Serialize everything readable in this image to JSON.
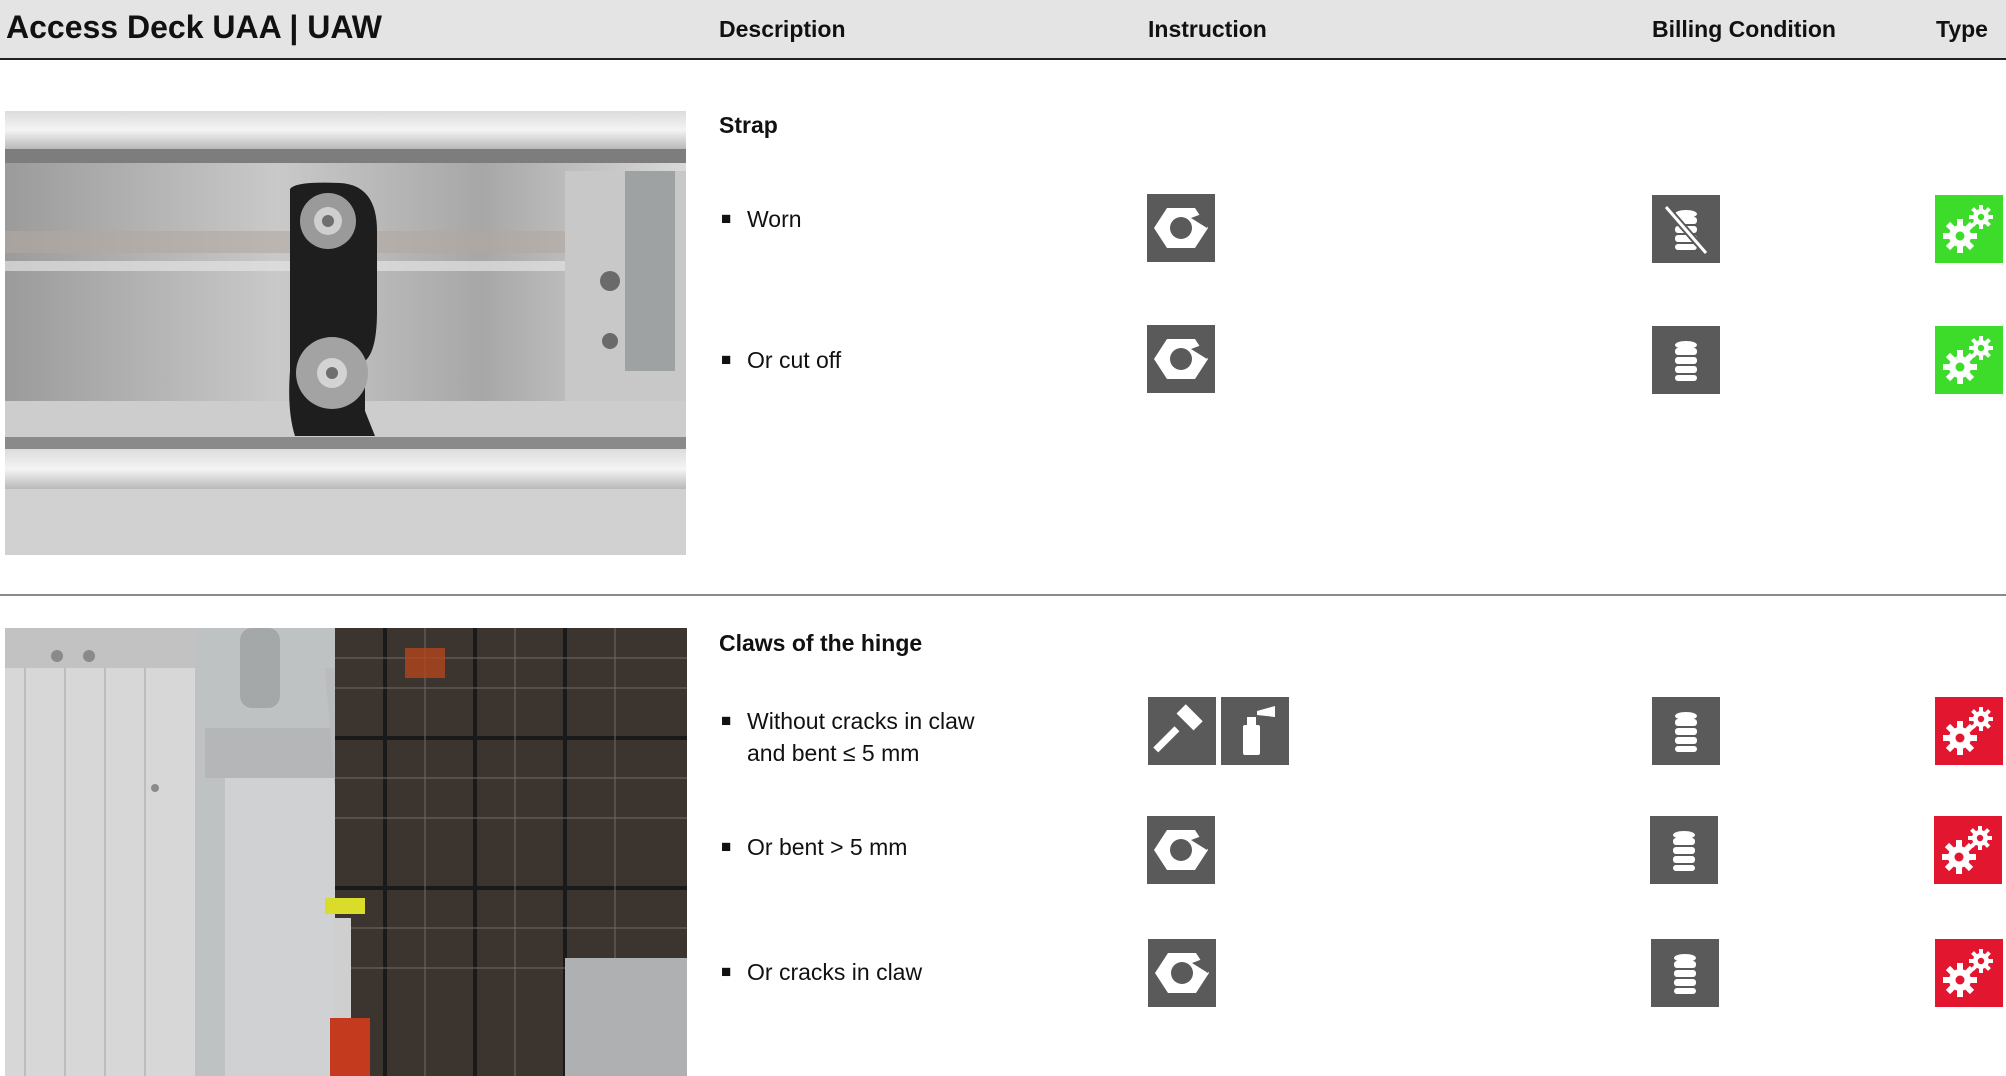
{
  "header": {
    "title": "Access Deck UAA | UAW",
    "columns": {
      "description": "Description",
      "instruction": "Instruction",
      "billing": "Billing Condition",
      "type": "Type"
    }
  },
  "sections": [
    {
      "title": "Strap",
      "photo": "strap-photo",
      "items": [
        {
          "text": "Worn",
          "instruction_icons": [
            "scrap-nut-icon"
          ],
          "billing_icon": "no-charge-coins-icon",
          "type_icon": "gears-icon",
          "type_color": "#3ddc2a"
        },
        {
          "text": "Or cut off",
          "instruction_icons": [
            "scrap-nut-icon"
          ],
          "billing_icon": "coins-icon",
          "type_icon": "gears-icon",
          "type_color": "#3ddc2a"
        }
      ]
    },
    {
      "title": "Claws of the hinge",
      "photo": "hinge-claw-photo",
      "items": [
        {
          "text_line1": "Without cracks in claw",
          "text_line2": "and bent ≤ 5 mm",
          "instruction_icons": [
            "hammer-icon",
            "spray-can-icon"
          ],
          "billing_icon": "coins-icon",
          "type_icon": "gears-icon",
          "type_color": "#e3162f"
        },
        {
          "text": "Or bent > 5 mm",
          "instruction_icons": [
            "scrap-nut-icon"
          ],
          "billing_icon": "coins-icon",
          "type_icon": "gears-icon",
          "type_color": "#e3162f"
        },
        {
          "text": "Or cracks in claw",
          "instruction_icons": [
            "scrap-nut-icon"
          ],
          "billing_icon": "coins-icon",
          "type_icon": "gears-icon",
          "type_color": "#e3162f"
        }
      ]
    }
  ],
  "bullet": "■"
}
